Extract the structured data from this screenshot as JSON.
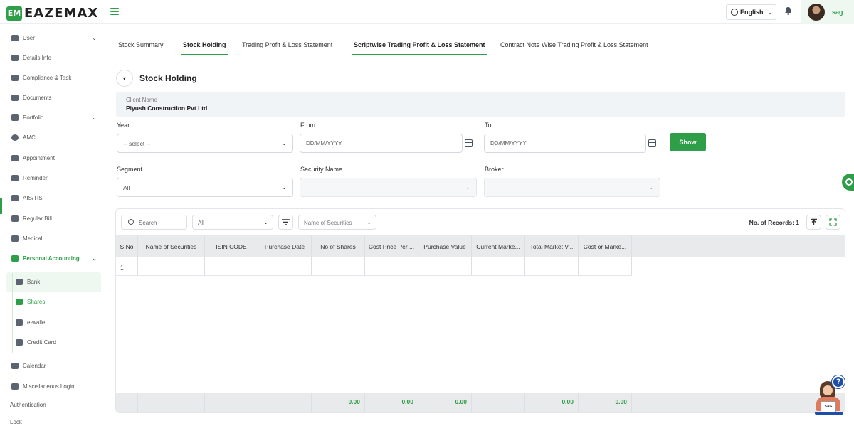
{
  "brand": {
    "logo_mark": "EM",
    "logo_text": "EAZEMAX",
    "accent_color": "#2e9e48"
  },
  "header": {
    "language": "English",
    "user_name": "sag"
  },
  "sidebar": {
    "items": [
      {
        "label": "User",
        "icon": "home-icon",
        "has_chevron": true
      },
      {
        "label": "Details Info",
        "icon": "id-card-icon"
      },
      {
        "label": "Compliance & Task",
        "icon": "tasks-icon"
      },
      {
        "label": "Documents",
        "icon": "document-icon"
      },
      {
        "label": "Portfolio",
        "icon": "person-icon",
        "has_chevron": true
      },
      {
        "label": "AMC",
        "icon": "circle-icon"
      },
      {
        "label": "Appointment",
        "icon": "calendar-icon"
      },
      {
        "label": "Reminder",
        "icon": "reminder-icon"
      },
      {
        "label": "AIS/TIS",
        "icon": "tag-icon"
      },
      {
        "label": "Regular Bill",
        "icon": "user-check-icon"
      },
      {
        "label": "Medical",
        "icon": "user-check-icon"
      },
      {
        "label": "Personal Accounting",
        "icon": "user-check-icon",
        "has_chevron": true,
        "active": true
      }
    ],
    "sub_items": [
      {
        "label": "Bank",
        "icon": "user-check-icon"
      },
      {
        "label": "Shares",
        "icon": "user-check-icon",
        "active": true
      },
      {
        "label": "e-wallet",
        "icon": "user-check-icon"
      },
      {
        "label": "Credit Card",
        "icon": "user-check-icon"
      }
    ],
    "bottom_items": [
      {
        "label": "Calendar",
        "icon": "user-check-icon"
      },
      {
        "label": "Miscellaneous Login",
        "icon": "user-check-icon"
      }
    ],
    "plain_items": [
      "Authentication",
      "Lock"
    ]
  },
  "tabs": [
    {
      "label": "Stock Summary"
    },
    {
      "label": "Stock Holding",
      "active": true
    },
    {
      "label": "Trading Profit & Loss Statement"
    },
    {
      "label": "Scriptwise Trading Profit & Loss Statement",
      "underlined": true
    },
    {
      "label": "Contract Note Wise Trading Profit & Loss Statement"
    }
  ],
  "page": {
    "title": "Stock Holding"
  },
  "client": {
    "label": "Client Name",
    "value": "Piyush Construction Pvt Ltd"
  },
  "filters": {
    "year": {
      "label": "Year",
      "value": "-- select --"
    },
    "from": {
      "label": "From",
      "placeholder": "DD/MM/YYYY"
    },
    "to": {
      "label": "To",
      "placeholder": "DD/MM/YYYY"
    },
    "show_label": "Show",
    "segment": {
      "label": "Segment",
      "value": "All"
    },
    "security_name": {
      "label": "Security Name",
      "value": ""
    },
    "broker": {
      "label": "Broker",
      "value": ""
    }
  },
  "table_toolbar": {
    "search_placeholder": "Search",
    "filter_value": "All",
    "column_select": "Name of Securities",
    "records_text": "No. of Records: 1"
  },
  "table": {
    "columns": [
      "S.No",
      "Name of Securities",
      "ISIN CODE",
      "Purchase Date",
      "No of Shares",
      "Cost Price Per ...",
      "Purchase Value",
      "Current Marke...",
      "Total Market V...",
      "Cost or Marke..."
    ],
    "rows": [
      [
        "1",
        "",
        "",
        "",
        "",
        "",
        "",
        "",
        "",
        ""
      ]
    ],
    "totals": [
      "",
      "",
      "",
      "",
      "0.00",
      "0.00",
      "0.00",
      "",
      "0.00",
      "0.00"
    ]
  },
  "helper": {
    "badge": "?",
    "laptop_text": "SAG"
  }
}
